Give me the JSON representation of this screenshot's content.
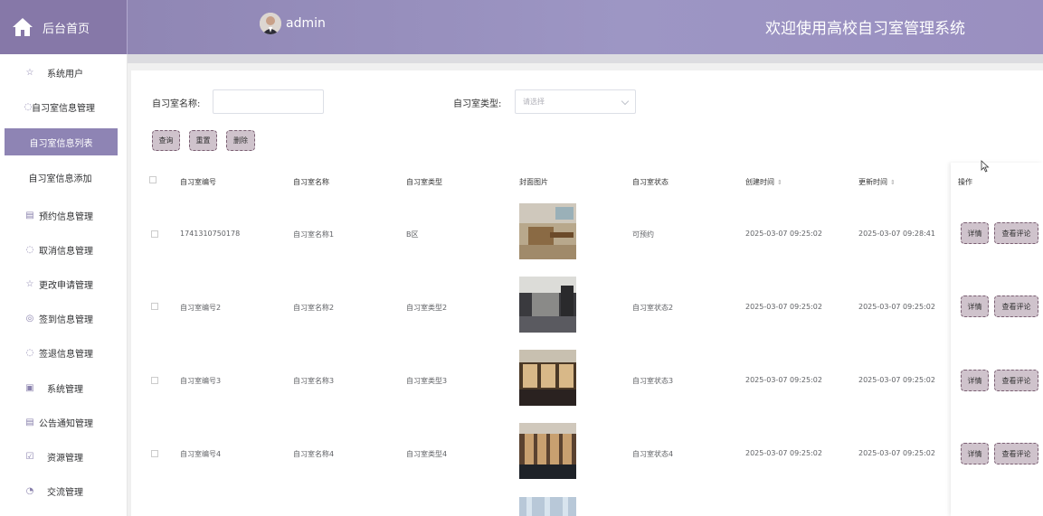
{
  "header": {
    "home_label": "后台首页",
    "username": "admin",
    "welcome": "欢迎使用高校自习室管理系统"
  },
  "sidebar": {
    "items": [
      {
        "label": "系统用户",
        "icon": "star-icon"
      },
      {
        "label": "自习室信息管理",
        "icon": "drop-icon"
      },
      {
        "label": "自习室信息列表",
        "icon": "",
        "active": true
      },
      {
        "label": "自习室信息添加",
        "icon": ""
      },
      {
        "label": "预约信息管理",
        "icon": "calendar-icon"
      },
      {
        "label": "取消信息管理",
        "icon": "drop-icon"
      },
      {
        "label": "更改申请管理",
        "icon": "star-icon"
      },
      {
        "label": "签到信息管理",
        "icon": "compass-icon"
      },
      {
        "label": "签退信息管理",
        "icon": "drop-icon"
      },
      {
        "label": "系统管理",
        "icon": "calendar-icon"
      },
      {
        "label": "公告通知管理",
        "icon": "calendar-icon"
      },
      {
        "label": "资源管理",
        "icon": "check-icon"
      },
      {
        "label": "交流管理",
        "icon": "clock-icon"
      }
    ]
  },
  "search": {
    "name_label": "自习室名称:",
    "name_value": "",
    "type_label": "自习室类型:",
    "type_placeholder": "请选择",
    "query_label": "查询",
    "reset_label": "重置",
    "delete_label": "删除"
  },
  "table": {
    "headers": [
      "自习室编号",
      "自习室名称",
      "自习室类型",
      "封面图片",
      "自习室状态",
      "创建时间",
      "更新时间",
      "操作"
    ],
    "rows": [
      {
        "code": "1741310750178",
        "name": "自习室名称1",
        "type": "B区",
        "status": "可预约",
        "created": "2025-03-07 09:25:02",
        "updated": "2025-03-07 09:28:41"
      },
      {
        "code": "自习室编号2",
        "name": "自习室名称2",
        "type": "自习室类型2",
        "status": "自习室状态2",
        "created": "2025-03-07 09:25:02",
        "updated": "2025-03-07 09:25:02"
      },
      {
        "code": "自习室编号3",
        "name": "自习室名称3",
        "type": "自习室类型3",
        "status": "自习室状态3",
        "created": "2025-03-07 09:25:02",
        "updated": "2025-03-07 09:25:02"
      },
      {
        "code": "自习室编号4",
        "name": "自习室名称4",
        "type": "自习室类型4",
        "status": "自习室状态4",
        "created": "2025-03-07 09:25:02",
        "updated": "2025-03-07 09:25:02"
      }
    ],
    "detail_label": "详情",
    "review_label": "查看评论"
  },
  "colors": {
    "accent": "#8e84b4",
    "header": "#9d96c4",
    "button": "#cfc3cc"
  }
}
